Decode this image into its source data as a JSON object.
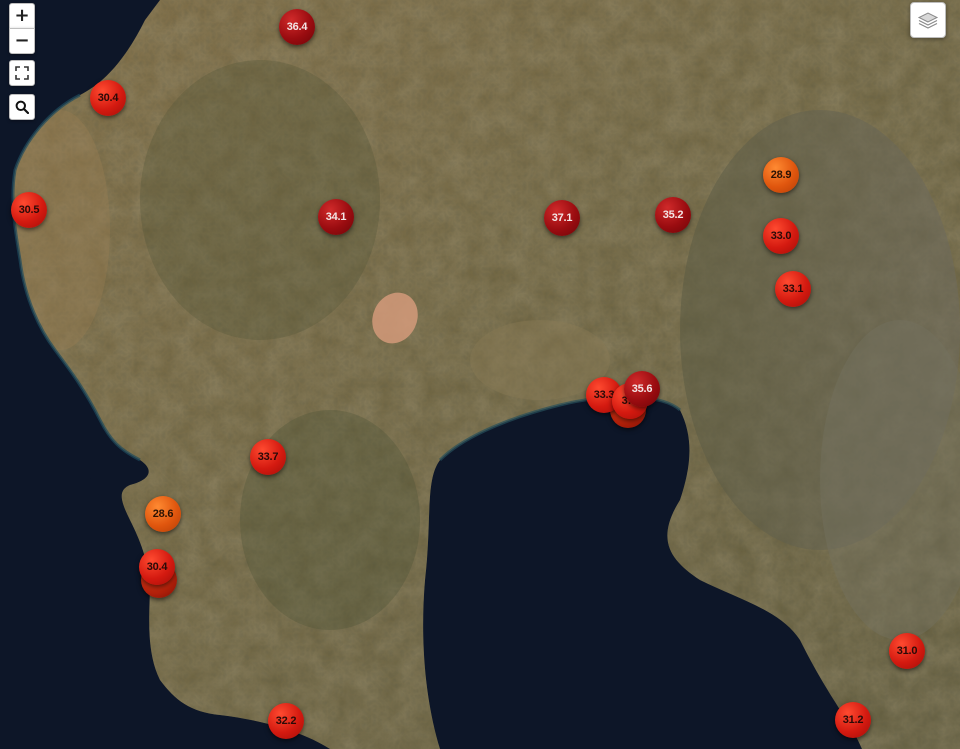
{
  "map": {
    "controls": {
      "zoom_in": "+",
      "zoom_out": "−"
    },
    "colors": {
      "sea": "#0d1628",
      "land": "#7a6a45",
      "marker_dark": "#9a0c10",
      "marker_red": "#d41a10",
      "marker_orange": "#e0560e"
    },
    "icons": [
      "plus-icon",
      "minus-icon",
      "fullscreen-icon",
      "search-icon",
      "layers-icon"
    ],
    "markers": [
      {
        "id": "m1",
        "value": "36.4",
        "tone": "dark"
      },
      {
        "id": "m2",
        "value": "30.4",
        "tone": "red"
      },
      {
        "id": "m3",
        "value": "30.5",
        "tone": "red"
      },
      {
        "id": "m4",
        "value": "34.1",
        "tone": "dark"
      },
      {
        "id": "m5",
        "value": "37.1",
        "tone": "dark"
      },
      {
        "id": "m6",
        "value": "35.2",
        "tone": "dark"
      },
      {
        "id": "m7",
        "value": "28.9",
        "tone": "orange"
      },
      {
        "id": "m8",
        "value": "33.0",
        "tone": "red"
      },
      {
        "id": "m9",
        "value": "33.1",
        "tone": "red"
      },
      {
        "id": "m10",
        "value": "33.3",
        "tone": "red"
      },
      {
        "id": "m11",
        "value": "3…",
        "tone": "red"
      },
      {
        "id": "m12",
        "value": "35.6",
        "tone": "dark"
      },
      {
        "id": "m13",
        "value": "33.7",
        "tone": "red"
      },
      {
        "id": "m14",
        "value": "28.6",
        "tone": "orange"
      },
      {
        "id": "m15",
        "value": "30.4",
        "tone": "red"
      },
      {
        "id": "m16",
        "value": "32.2",
        "tone": "red"
      },
      {
        "id": "m17",
        "value": "31.0",
        "tone": "red"
      },
      {
        "id": "m18",
        "value": "31.2",
        "tone": "red"
      }
    ]
  }
}
